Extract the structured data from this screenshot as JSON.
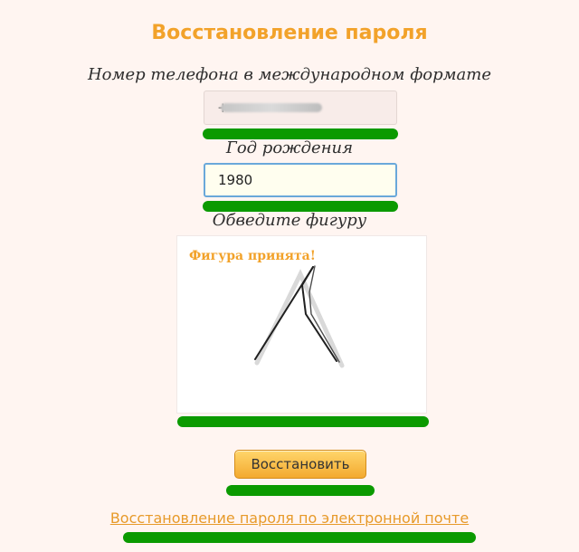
{
  "page": {
    "title": "Восстановление пароля"
  },
  "form": {
    "phone_label": "Номер телефона в международном формате",
    "phone_value": "+",
    "year_label": "Год рождения",
    "year_value": "1980",
    "figure_label": "Обведите фигуру",
    "figure_status": "Фигура принята!"
  },
  "actions": {
    "submit_label": "Восстановить",
    "email_link": "Восстановление пароля по электронной почте"
  },
  "colors": {
    "accent_orange": "#f2a22a",
    "green_highlight": "#0b9a00",
    "input_focus_border": "#6aa8da"
  }
}
